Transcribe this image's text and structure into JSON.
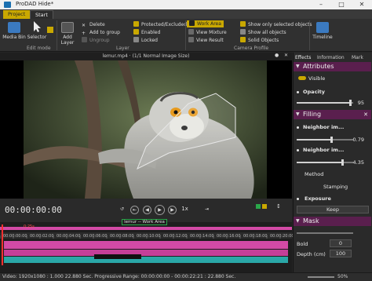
{
  "window": {
    "title": "ProDAD Hide*"
  },
  "tabs": {
    "project": "Project",
    "start": "Start"
  },
  "ribbon": {
    "media_bin": "Media Bin",
    "selector": "Selector",
    "edit_mode_group": "Edit mode",
    "add_layer": "Add Layer",
    "delete": "Delete",
    "add_to_group": "Add to group",
    "ungroup": "Ungroup",
    "layer_group": "Layer",
    "protected_excluded": "Protected/Excluded",
    "enabled": "Enabled",
    "locked": "Locked",
    "work_area": "Work Area",
    "view_mixture": "View Mixture",
    "view_result": "View Result",
    "show_only_selected": "Show only selected objects",
    "show_all_objects": "Show all objects",
    "solid_objects": "Solid Objects",
    "camera_profile_group": "Camera Profile",
    "timeline": "Timeline"
  },
  "viewer": {
    "caption": "lemur.mp4 · (1/1  Normal Image Size)"
  },
  "transport": {
    "timecode": "00:00:00:00",
    "speed": "1x"
  },
  "timeline": {
    "clip_label": "lemur -- Work Area",
    "marker": "0:25s",
    "ticks": [
      "00:00:00:00",
      "00:00:02:00",
      "00:00:04:00",
      "00:00:06:00",
      "00:00:08:00",
      "00:00:10:00",
      "00:00:12:00",
      "00:00:14:00",
      "00:00:16:00",
      "00:00:18:00",
      "00:00:20:00"
    ]
  },
  "status": {
    "text": "Video: 1920x1080 : 1.000  22.880 Sec.  Progressive  Range: 00:00:00:00 - 00:00:22:21 : 22.880 Sec.",
    "zoom": "50%"
  },
  "panel": {
    "tabs": [
      "Effects",
      "Information",
      "Mark"
    ],
    "attributes": {
      "title": "Attributes",
      "visible": "Visible",
      "opacity_label": "Opacity",
      "opacity_value": "95"
    },
    "filling": {
      "title": "Filling",
      "neighbor1_label": "Neighbor im...",
      "neighbor1_value": "0.79",
      "neighbor2_label": "Neighbor im...",
      "neighbor2_value": "4.35",
      "method_label": "Method",
      "method_value": "Stamping",
      "exposure_label": "Exposure",
      "exposure_value": "Keep"
    },
    "mask": {
      "title": "Mask",
      "bold_label": "Bold",
      "bold_value": "0",
      "depth_label": "Depth (cm)",
      "depth_value": "100"
    }
  },
  "colors": {
    "accent": "#c9a800",
    "section": "#5a1f4e",
    "clip": "#d34aa6",
    "teal": "#2aa7a7"
  }
}
